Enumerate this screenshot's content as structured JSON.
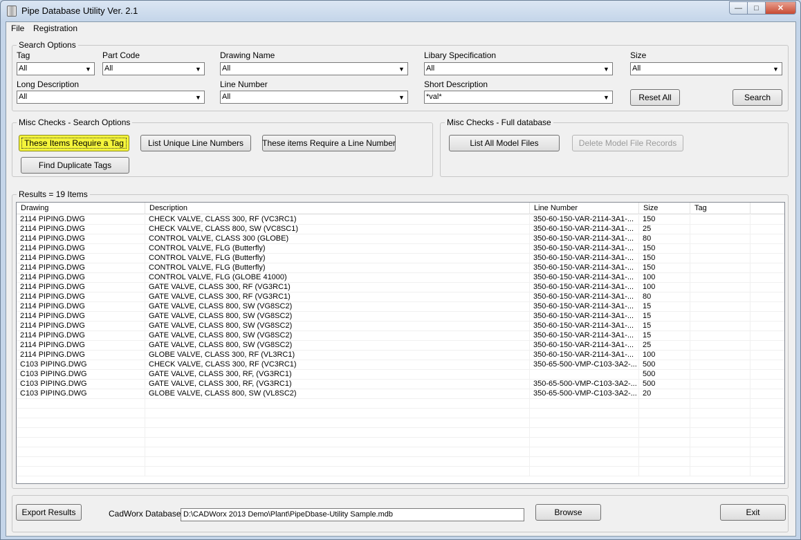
{
  "window": {
    "title": "Pipe Database Utility Ver. 2.1",
    "minimize": "—",
    "maximize": "□",
    "close": "✕"
  },
  "menu": {
    "file": "File",
    "registration": "Registration"
  },
  "search": {
    "group_label": "Search Options",
    "tag": {
      "label": "Tag",
      "value": "All"
    },
    "part_code": {
      "label": "Part Code",
      "value": "All"
    },
    "drawing_name": {
      "label": "Drawing Name",
      "value": "All"
    },
    "library_spec": {
      "label": "Libary Specification",
      "value": "All"
    },
    "size": {
      "label": "Size",
      "value": "All"
    },
    "long_description": {
      "label": "Long Description",
      "value": "All"
    },
    "line_number": {
      "label": "Line Number",
      "value": "All"
    },
    "short_description": {
      "label": "Short Description",
      "value": "*val*"
    },
    "reset_label": "Reset All",
    "search_label": "Search"
  },
  "misc_search": {
    "group_label": "Misc Checks - Search Options",
    "require_tag": "These Items Require a Tag",
    "unique_lines": "List Unique Line Numbers",
    "require_line": "These items Require a Line Number",
    "duplicate_tags": "Find Duplicate Tags"
  },
  "misc_full": {
    "group_label": "Misc Checks - Full database",
    "list_model_files": "List All Model Files",
    "delete_records": "Delete Model File Records"
  },
  "results": {
    "group_label": "Results = 19 Items",
    "columns": [
      "Drawing",
      "Description",
      "Line Number",
      "Size",
      "Tag"
    ],
    "rows": [
      [
        "2114 PIPING.DWG",
        "CHECK VALVE, CLASS 300, RF (VC3RC1)",
        "350-60-150-VAR-2114-3A1-...",
        "150",
        ""
      ],
      [
        "2114 PIPING.DWG",
        "CHECK VALVE, CLASS 800, SW (VC8SC1)",
        "350-60-150-VAR-2114-3A1-...",
        "25",
        ""
      ],
      [
        "2114 PIPING.DWG",
        "CONTROL VALVE, CLASS 300 (GLOBE)",
        "350-60-150-VAR-2114-3A1-...",
        "80",
        ""
      ],
      [
        "2114 PIPING.DWG",
        "CONTROL VALVE, FLG (Butterfly)",
        "350-60-150-VAR-2114-3A1-...",
        "150",
        ""
      ],
      [
        "2114 PIPING.DWG",
        "CONTROL VALVE, FLG (Butterfly)",
        "350-60-150-VAR-2114-3A1-...",
        "150",
        ""
      ],
      [
        "2114 PIPING.DWG",
        "CONTROL VALVE, FLG (Butterfly)",
        "350-60-150-VAR-2114-3A1-...",
        "150",
        ""
      ],
      [
        "2114 PIPING.DWG",
        "CONTROL VALVE, FLG (GLOBE 41000)",
        "350-60-150-VAR-2114-3A1-...",
        "100",
        ""
      ],
      [
        "2114 PIPING.DWG",
        "GATE VALVE, CLASS 300, RF (VG3RC1)",
        "350-60-150-VAR-2114-3A1-...",
        "100",
        ""
      ],
      [
        "2114 PIPING.DWG",
        "GATE VALVE, CLASS 300, RF (VG3RC1)",
        "350-60-150-VAR-2114-3A1-...",
        "80",
        ""
      ],
      [
        "2114 PIPING.DWG",
        "GATE VALVE, CLASS 800, SW (VG8SC2)",
        "350-60-150-VAR-2114-3A1-...",
        "15",
        ""
      ],
      [
        "2114 PIPING.DWG",
        "GATE VALVE, CLASS 800, SW (VG8SC2)",
        "350-60-150-VAR-2114-3A1-...",
        "15",
        ""
      ],
      [
        "2114 PIPING.DWG",
        "GATE VALVE, CLASS 800, SW (VG8SC2)",
        "350-60-150-VAR-2114-3A1-...",
        "15",
        ""
      ],
      [
        "2114 PIPING.DWG",
        "GATE VALVE, CLASS 800, SW (VG8SC2)",
        "350-60-150-VAR-2114-3A1-...",
        "15",
        ""
      ],
      [
        "2114 PIPING.DWG",
        "GATE VALVE, CLASS 800, SW (VG8SC2)",
        "350-60-150-VAR-2114-3A1-...",
        "25",
        ""
      ],
      [
        "2114 PIPING.DWG",
        "GLOBE VALVE, CLASS 300, RF (VL3RC1)",
        "350-60-150-VAR-2114-3A1-...",
        "100",
        ""
      ],
      [
        "C103 PIPING.DWG",
        "CHECK VALVE, CLASS 300, RF (VC3RC1)",
        "350-65-500-VMP-C103-3A2-...",
        "500",
        ""
      ],
      [
        "C103 PIPING.DWG",
        "GATE VALVE, CLASS 300, RF, (VG3RC1)",
        "",
        "500",
        ""
      ],
      [
        "C103 PIPING.DWG",
        "GATE VALVE, CLASS 300, RF, (VG3RC1)",
        "350-65-500-VMP-C103-3A2-...",
        "500",
        ""
      ],
      [
        "C103 PIPING.DWG",
        "GLOBE VALVE, CLASS 800, SW (VL8SC2)",
        "350-65-500-VMP-C103-3A2-...",
        "20",
        ""
      ]
    ]
  },
  "footer": {
    "export_label": "Export Results",
    "db_label": "CadWorx Database:",
    "db_path": "D:\\CADWorx 2013 Demo\\Plant\\PipeDbase-Utility Sample.mdb",
    "browse_label": "Browse",
    "exit_label": "Exit"
  },
  "colors": {
    "highlight_button": "#f5f53a",
    "window_frame": "#c4d5e9"
  },
  "icons": {
    "dropdown": "▼"
  }
}
